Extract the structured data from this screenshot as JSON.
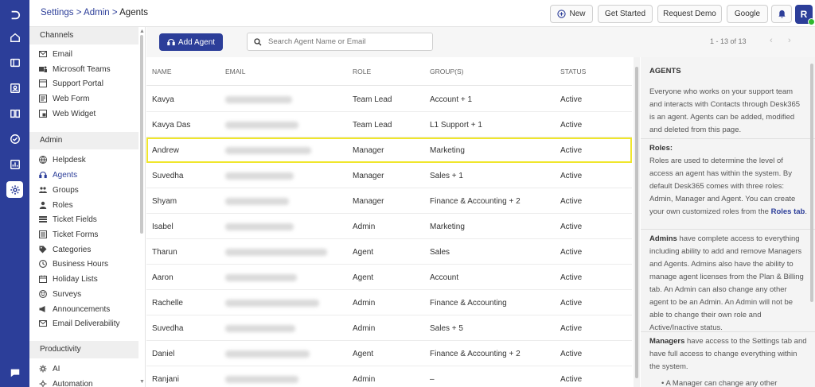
{
  "header": {
    "breadcrumb": [
      "Settings",
      "Admin",
      "Agents"
    ],
    "buttons": {
      "new": "New",
      "get_started": "Get Started",
      "request_demo": "Request Demo",
      "google": "Google"
    },
    "avatar_letter": "R"
  },
  "sidebar": {
    "sections": [
      {
        "title": "Channels",
        "items": [
          "Email",
          "Microsoft Teams",
          "Support Portal",
          "Web Form",
          "Web Widget"
        ]
      },
      {
        "title": "Admin",
        "items": [
          "Helpdesk",
          "Agents",
          "Groups",
          "Roles",
          "Ticket Fields",
          "Ticket Forms",
          "Categories",
          "Business Hours",
          "Holiday Lists",
          "Surveys",
          "Announcements",
          "Email Deliverability"
        ]
      },
      {
        "title": "Productivity",
        "items": [
          "AI",
          "Automation"
        ]
      }
    ],
    "active_item": "Agents"
  },
  "toolbar": {
    "add_agent": "Add Agent",
    "search_placeholder": "Search Agent Name or Email",
    "pagination": "1 - 13 of 13"
  },
  "table": {
    "columns": [
      "NAME",
      "EMAIL",
      "ROLE",
      "GROUP(S)",
      "STATUS"
    ],
    "rows": [
      {
        "name": "Kavya",
        "role": "Team Lead",
        "groups": "Account + 1",
        "status": "Active"
      },
      {
        "name": "Kavya Das",
        "role": "Team Lead",
        "groups": "L1 Support + 1",
        "status": "Active"
      },
      {
        "name": "Andrew",
        "role": "Manager",
        "groups": "Marketing",
        "status": "Active"
      },
      {
        "name": "Suvedha",
        "role": "Manager",
        "groups": "Sales + 1",
        "status": "Active"
      },
      {
        "name": "Shyam",
        "role": "Manager",
        "groups": "Finance & Accounting + 2",
        "status": "Active"
      },
      {
        "name": "Isabel",
        "role": "Admin",
        "groups": "Marketing",
        "status": "Active"
      },
      {
        "name": "Tharun",
        "role": "Agent",
        "groups": "Sales",
        "status": "Active"
      },
      {
        "name": "Aaron",
        "role": "Agent",
        "groups": "Account",
        "status": "Active"
      },
      {
        "name": "Rachelle",
        "role": "Admin",
        "groups": "Finance & Accounting",
        "status": "Active"
      },
      {
        "name": "Suvedha",
        "role": "Admin",
        "groups": "Sales + 5",
        "status": "Active"
      },
      {
        "name": "Daniel",
        "role": "Agent",
        "groups": "Finance & Accounting + 2",
        "status": "Active"
      },
      {
        "name": "Ranjani",
        "role": "Admin",
        "groups": "–",
        "status": "Active"
      }
    ]
  },
  "help": {
    "title": "AGENTS",
    "intro": "Everyone who works on your support team and interacts with Contacts through Desk365 is an agent. Agents can be added, modified and deleted from this page.",
    "roles_heading": "Roles:",
    "roles_text": "Roles are used to determine the level of access an agent has within the system. By default Desk365 comes with three roles: Admin, Manager and Agent. You can create your own customized roles from the ",
    "roles_link": "Roles tab",
    "admins_bold": "Admins",
    "admins_text": " have complete access to everything including ability to add and remove Managers and Agents. Admins also have the ability to manage agent licenses from the Plan & Billing tab. An Admin can also change any other agent to be an Admin. An Admin will not be able to change their own role and Active/Inactive status.",
    "managers_bold": "Managers",
    "managers_text": " have access to the Settings tab and have full access to change everything within the system.",
    "bullet": "A Manager can change any other"
  }
}
